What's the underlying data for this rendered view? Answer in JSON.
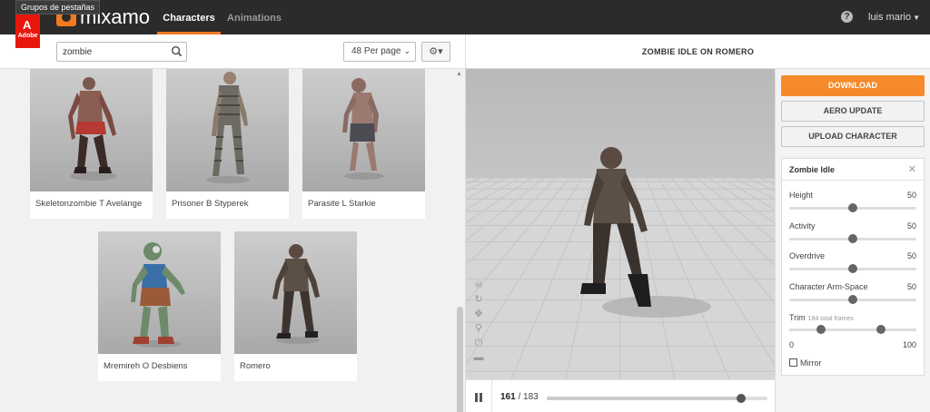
{
  "browser": {
    "tab_groups_tooltip": "Grupos de pestañas",
    "adobe_label": "Adobe"
  },
  "header": {
    "logo": "mixamo",
    "tabs": [
      {
        "label": "Characters",
        "active": true
      },
      {
        "label": "Animations",
        "active": false
      }
    ],
    "help_icon": "question-circle-icon",
    "user": "luis mario"
  },
  "toolbar": {
    "search_value": "zombie",
    "per_page": "48 Per page"
  },
  "characters": [
    {
      "name": "Skeletonzombie T Avelange"
    },
    {
      "name": "Prisoner B Styperek"
    },
    {
      "name": "Parasite L Starkie"
    },
    {
      "name": "Mremireh O Desbiens"
    },
    {
      "name": "Romero"
    }
  ],
  "viewer": {
    "title": "ZOMBIE IDLE ON ROMERO",
    "current_frame": "161",
    "total_frames": "183",
    "progress_percent": 88
  },
  "actions": {
    "download": "DOWNLOAD",
    "aero": "AERO UPDATE",
    "upload": "UPLOAD CHARACTER"
  },
  "animation_panel": {
    "title": "Zombie Idle",
    "sliders": [
      {
        "label": "Height",
        "value": "50"
      },
      {
        "label": "Activity",
        "value": "50"
      },
      {
        "label": "Overdrive",
        "value": "50"
      },
      {
        "label": "Character Arm-Space",
        "value": "50"
      }
    ],
    "trim": {
      "label": "Trim",
      "sub": "184 total frames",
      "min": "0",
      "max": "100",
      "low_percent": 25,
      "high_percent": 72
    },
    "mirror": "Mirror"
  },
  "colors": {
    "accent": "#f48a2a",
    "topbar": "#2b2b2b",
    "adobe": "#e8170c"
  }
}
